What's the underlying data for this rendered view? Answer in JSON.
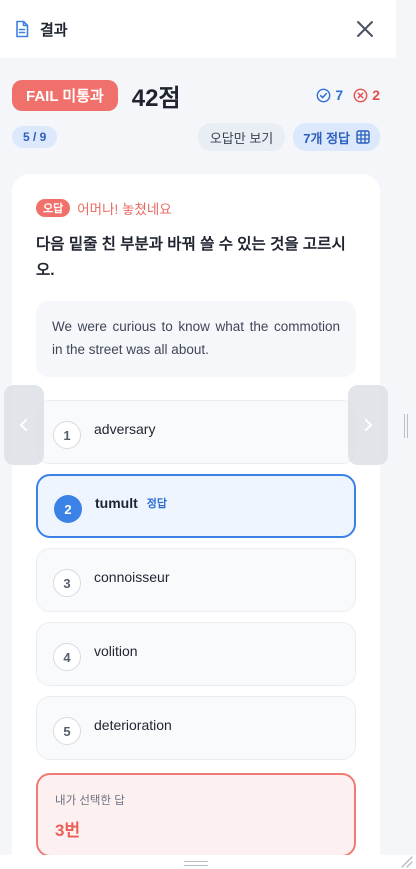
{
  "header": {
    "title": "결과",
    "icon": "document-icon",
    "close_icon": "close-icon"
  },
  "summary": {
    "status_label": "FAIL 미통과",
    "score": "42점",
    "correct_count": "7",
    "wrong_count": "2",
    "page": "5 / 9",
    "wrong_only_label": "오답만 보기",
    "answer_count_label": "7개 정답"
  },
  "question": {
    "tag": "오답",
    "message": "어머나! 놓쳤네요",
    "prompt": "다음 밑줄 친 부분과 바꿔 쓸 수 있는 것을 고르시오.",
    "passage": "We were curious to know what the commotion in the street was all about.",
    "options": [
      {
        "num": "1",
        "text": "adversary"
      },
      {
        "num": "2",
        "text": "tumult",
        "tag": "정답"
      },
      {
        "num": "3",
        "text": "connoisseur"
      },
      {
        "num": "4",
        "text": "volition"
      },
      {
        "num": "5",
        "text": "deterioration"
      }
    ],
    "my_answer_label": "내가 선택한 답",
    "my_answer_value": "3번"
  },
  "colors": {
    "fail": "#f0716b",
    "accent": "#3b82e6",
    "wrong": "#e2504b"
  }
}
